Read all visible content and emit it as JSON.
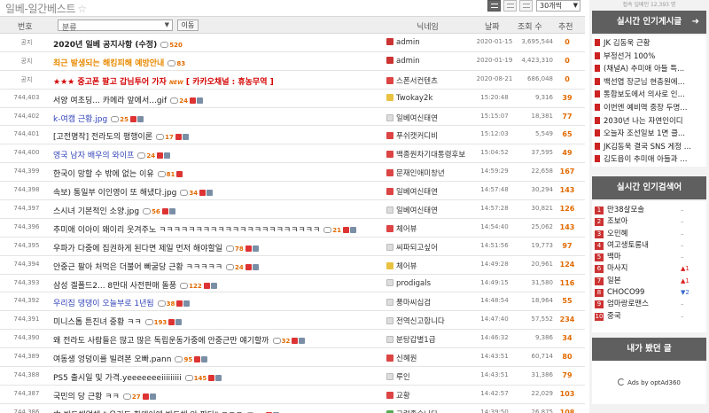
{
  "header": {
    "title": "일베-일간베스트",
    "per_page": "30개씩"
  },
  "table": {
    "columns": {
      "no": "번호",
      "category": "분류",
      "move": "이동",
      "nick": "닉네임",
      "date": "날짜",
      "views": "조회 수",
      "rec": "추천"
    },
    "rows": [
      {
        "no": "공지",
        "title": "2020년 일베 공지사항 (수정)",
        "cmt": "520",
        "nick": "admin",
        "date": "2020-01-15",
        "views": "3,695,544",
        "rec": "0"
      },
      {
        "no": "공지",
        "title": "최근 발생되는 해킹피해 예방안내",
        "cmt": "83",
        "nick": "admin",
        "date": "2020-01-19",
        "views": "4,423,310",
        "rec": "0"
      },
      {
        "no": "공지",
        "title_prefix": "★★★ 중고폰 팔고 갑님투어 가자 ",
        "title_new": "NEW",
        "title_tail": " [ 카카오채널 : 휴농무역 ]",
        "nick": "스폰서컨텐츠",
        "date": "2020-08-21",
        "views": "686,048",
        "rec": "0"
      },
      {
        "no": "744,403",
        "title": "서양 여초딩... 카메라 앞에서...gif",
        "cmt": "24",
        "nick": "Twokay2k",
        "date": "15:20:48",
        "views": "9,316",
        "rec": "39"
      },
      {
        "no": "744,402",
        "title": "k-여캠 근황.jpg",
        "cmt": "25",
        "nick": "일베여신태연",
        "date": "15:15:07",
        "views": "18,381",
        "rec": "77"
      },
      {
        "no": "744,401",
        "title": "[고전명작] 전라도의 평행이론",
        "cmt": "17",
        "nick": "푸쉬캣커디비",
        "date": "15:12:03",
        "views": "5,549",
        "rec": "65"
      },
      {
        "no": "744,400",
        "title": "영국 남자 배우의 와이프",
        "cmt": "24",
        "nick": "백종원차기대통령후보",
        "date": "15:04:52",
        "views": "37,595",
        "rec": "49"
      },
      {
        "no": "744,399",
        "title": "한국이 망할 수 밖에 없는 이유",
        "cmt": "81",
        "nick": "문재인애미창년",
        "date": "14:59:29",
        "views": "22,658",
        "rec": "167"
      },
      {
        "no": "744,398",
        "title": "속보) 통일부 이인영이 또 해냈다.jpg",
        "cmt": "34",
        "nick": "일베여신태연",
        "date": "14:57:48",
        "views": "30,294",
        "rec": "143"
      },
      {
        "no": "744,397",
        "title": "스시녀 기본적인 소양.jpg",
        "cmt": "56",
        "nick": "일베여신태연",
        "date": "14:57:28",
        "views": "30,821",
        "rec": "126"
      },
      {
        "no": "744,396",
        "title": "추미애 이아이 왜이리 웃겨주노 ㅋㅋㅋㅋㅋㅋㅋㅋㅋㅋㅋㅋㅋㅋㅋㅋㅋㅋㅋㅋㅋㅋ",
        "cmt": "21",
        "nick": "체어뷰",
        "date": "14:54:40",
        "views": "25,062",
        "rec": "143"
      },
      {
        "no": "744,395",
        "title": "우파가 다중에 집권하게 된다면 제일 먼저 해야할일",
        "cmt": "78",
        "nick": "씨파되고싶어",
        "date": "14:51:56",
        "views": "19,773",
        "rec": "97"
      },
      {
        "no": "744,394",
        "title": "안중근 팔아 처먹은 더불어 빠굴당 근황 ㅋㅋㅋㅋㅋ",
        "cmt": "24",
        "nick": "체어뷰",
        "date": "14:49:28",
        "views": "20,961",
        "rec": "124"
      },
      {
        "no": "744,393",
        "title": "삼성 겔폴드2... 8만대 사전판매 돌풍",
        "cmt": "122",
        "nick": "prodigals",
        "date": "14:49:15",
        "views": "31,580",
        "rec": "116"
      },
      {
        "no": "744,392",
        "title": "우리집 댕댕이 오늘부로 1년됨",
        "cmt": "38",
        "nick": "풍마씨십검",
        "date": "14:48:54",
        "views": "18,964",
        "rec": "55"
      },
      {
        "no": "744,391",
        "title": "미니스톱 튼진녀 중황 ㅋㅋ",
        "cmt": "193",
        "nick": "전역신고합니다",
        "date": "14:47:40",
        "views": "57,552",
        "rec": "234"
      },
      {
        "no": "744,390",
        "title": "왜 전라도 사람들은 많고 많은 독립운동가중에 안중근만 얘기할까",
        "cmt": "32",
        "nick": "분탕갑별1급",
        "date": "14:46:32",
        "views": "9,386",
        "rec": "34"
      },
      {
        "no": "744,389",
        "title": "여동생 엉덩이를 빌려본 오빠.pann",
        "cmt": "95",
        "nick": "신혜원",
        "date": "14:43:51",
        "views": "60,714",
        "rec": "80"
      },
      {
        "no": "744,388",
        "title": "PS5 출시일 및 가격.yeeeeeeeiiiiiiiii",
        "cmt": "145",
        "nick": "루인",
        "date": "14:43:51",
        "views": "31,386",
        "rec": "79"
      },
      {
        "no": "744,387",
        "title": "국민의 당 근황 ㅋㅋ",
        "cmt": "27",
        "nick": "교황",
        "date": "14:42:57",
        "views": "22,029",
        "rec": "103"
      },
      {
        "no": "744,386",
        "title": "中 반도체업체 \" 우리도 화웨이에 반도체 안 판다\" ㅋㅋㅋ",
        "cmt": "29",
        "nick": "그럼좋습니다",
        "date": "14:39:50",
        "views": "26,875",
        "rec": "108"
      }
    ]
  },
  "sidebar": {
    "top_text": "접속 일베인 12,393 명",
    "hot_posts_title": "실시간 인기게시글",
    "hot_posts": [
      "JK 김동욱 근황",
      "부정선거 100%",
      "(채널A) 추미애 아들 특...",
      "백선엽 장군님 현충원에...",
      "통합보도에서 의사로 인...",
      "이번엔 예비역 중장 두명...",
      "2030년 나는 자연인이디",
      "오늘자 조선일보 1면 클...",
      "JK김동욱 결국 SNS 게정 ...",
      "김도읍이 추미애 아들과 ..."
    ],
    "keywords_title": "실시간 인기검색어",
    "keywords": [
      {
        "rank": "1",
        "word": "만38살모솔",
        "change": "–"
      },
      {
        "rank": "2",
        "word": "조보아",
        "change": "–"
      },
      {
        "rank": "3",
        "word": "오민혜",
        "change": "–"
      },
      {
        "rank": "4",
        "word": "여고생토롱내",
        "change": "–"
      },
      {
        "rank": "5",
        "word": "백마",
        "change": "–"
      },
      {
        "rank": "6",
        "word": "마사지",
        "change": "▲1"
      },
      {
        "rank": "7",
        "word": "일본",
        "change": "▲1"
      },
      {
        "rank": "8",
        "word": "CHOCO99",
        "change": "▼2"
      },
      {
        "rank": "9",
        "word": "엄마랑로맨스",
        "change": "–"
      },
      {
        "rank": "10",
        "word": "중국",
        "change": "–"
      }
    ],
    "viewed_title": "내가 봤던 글",
    "ads_text": "Ads by optAd360"
  },
  "colors": {
    "accent": "#e26a00",
    "panel": "#5f5f5f",
    "notice_title": "#e88a00",
    "link_blue": "#3344bb"
  }
}
